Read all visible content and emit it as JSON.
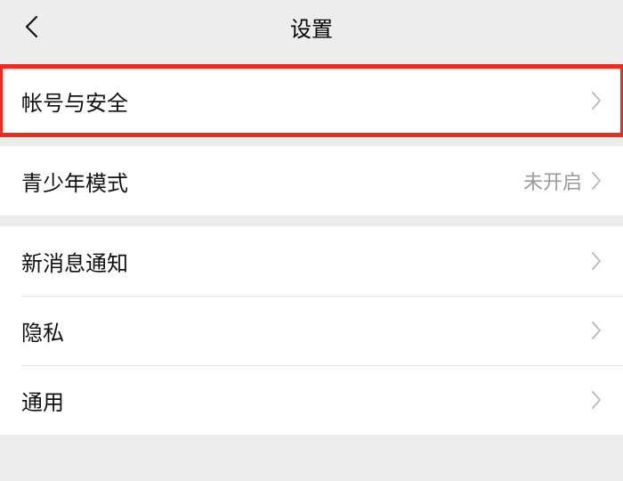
{
  "header": {
    "title": "设置"
  },
  "groups": [
    {
      "items": [
        {
          "key": "account-security",
          "label": "帐号与安全",
          "value": "",
          "highlighted": true
        }
      ]
    },
    {
      "items": [
        {
          "key": "youth-mode",
          "label": "青少年模式",
          "value": "未开启",
          "highlighted": false
        }
      ]
    },
    {
      "items": [
        {
          "key": "new-message-notify",
          "label": "新消息通知",
          "value": "",
          "highlighted": false
        },
        {
          "key": "privacy",
          "label": "隐私",
          "value": "",
          "highlighted": false
        },
        {
          "key": "general",
          "label": "通用",
          "value": "",
          "highlighted": false
        }
      ]
    }
  ]
}
